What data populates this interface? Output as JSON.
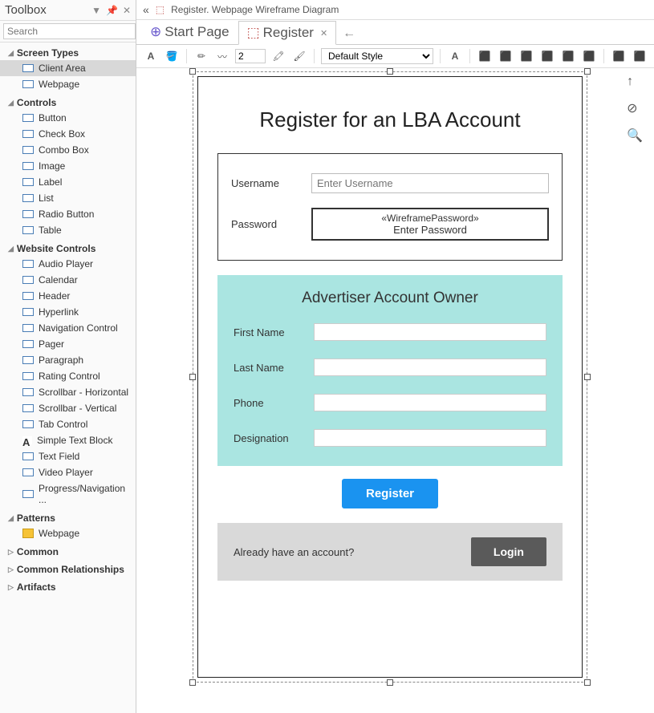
{
  "toolbox": {
    "title": "Toolbox",
    "search_placeholder": "Search",
    "groups": [
      {
        "label": "Screen Types",
        "expanded": true,
        "items": [
          {
            "label": "Client Area",
            "icon": "rect",
            "selected": true
          },
          {
            "label": "Webpage",
            "icon": "rect"
          }
        ]
      },
      {
        "label": "Controls",
        "expanded": true,
        "items": [
          {
            "label": "Button",
            "icon": "rect"
          },
          {
            "label": "Check Box",
            "icon": "rect"
          },
          {
            "label": "Combo Box",
            "icon": "rect"
          },
          {
            "label": "Image",
            "icon": "rect"
          },
          {
            "label": "Label",
            "icon": "rect"
          },
          {
            "label": "List",
            "icon": "rect"
          },
          {
            "label": "Radio Button",
            "icon": "rect"
          },
          {
            "label": "Table",
            "icon": "rect"
          }
        ]
      },
      {
        "label": "Website Controls",
        "expanded": true,
        "items": [
          {
            "label": "Audio Player",
            "icon": "rect"
          },
          {
            "label": "Calendar",
            "icon": "rect"
          },
          {
            "label": "Header",
            "icon": "rect"
          },
          {
            "label": "Hyperlink",
            "icon": "rect"
          },
          {
            "label": "Navigation Control",
            "icon": "rect"
          },
          {
            "label": "Pager",
            "icon": "rect"
          },
          {
            "label": "Paragraph",
            "icon": "rect"
          },
          {
            "label": "Rating Control",
            "icon": "rect"
          },
          {
            "label": "Scrollbar - Horizontal",
            "icon": "rect"
          },
          {
            "label": "Scrollbar - Vertical",
            "icon": "rect"
          },
          {
            "label": "Tab Control",
            "icon": "rect"
          },
          {
            "label": "Simple Text Block",
            "icon": "text"
          },
          {
            "label": "Text Field",
            "icon": "rect"
          },
          {
            "label": "Video Player",
            "icon": "rect"
          },
          {
            "label": "Progress/Navigation ...",
            "icon": "rect"
          }
        ]
      },
      {
        "label": "Patterns",
        "expanded": true,
        "items": [
          {
            "label": "Webpage",
            "icon": "folder"
          }
        ]
      },
      {
        "label": "Common",
        "expanded": false,
        "items": []
      },
      {
        "label": "Common Relationships",
        "expanded": false,
        "items": []
      },
      {
        "label": "Artifacts",
        "expanded": false,
        "items": []
      }
    ]
  },
  "topbar": {
    "breadcrumb": "Register.  Webpage Wireframe Diagram"
  },
  "tabs": [
    {
      "label": "Start Page",
      "active": false
    },
    {
      "label": "Register",
      "active": true
    }
  ],
  "formatbar": {
    "line_width": "2",
    "style": "Default Style"
  },
  "wireframe": {
    "title": "Register for an LBA Account",
    "credentials": {
      "username_label": "Username",
      "username_placeholder": "Enter Username",
      "password_label": "Password",
      "password_stereotype": "«WireframePassword»",
      "password_placeholder": "Enter Password"
    },
    "owner": {
      "title": "Advertiser Account Owner",
      "fields": [
        {
          "label": "First Name"
        },
        {
          "label": "Last Name"
        },
        {
          "label": "Phone"
        },
        {
          "label": "Designation"
        }
      ]
    },
    "register_button": "Register",
    "login": {
      "text": "Already have an account?",
      "button": "Login"
    }
  }
}
